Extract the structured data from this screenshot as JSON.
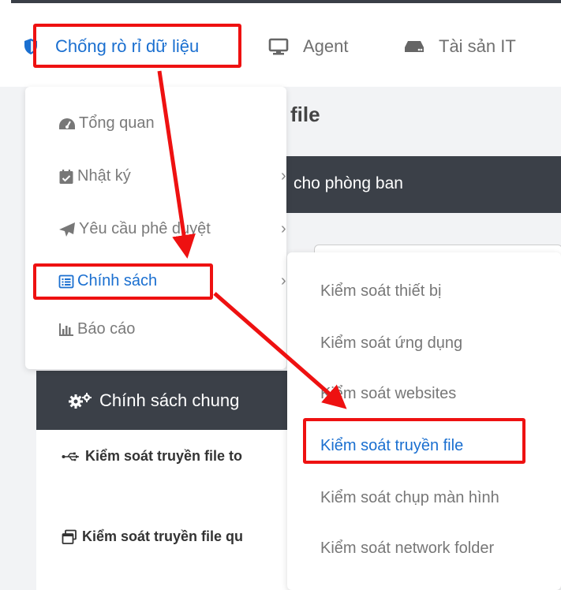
{
  "navbar": {
    "items": [
      {
        "label": "Chống rò rỉ dữ liệu",
        "icon": "shield-icon",
        "active": true
      },
      {
        "label": "Agent",
        "icon": "monitor-icon"
      },
      {
        "label": "Tài sản IT",
        "icon": "hard-drive-icon"
      }
    ]
  },
  "page": {
    "title_fragment": "file",
    "dark_bar_text": "cho phòng ban"
  },
  "menu": {
    "items": [
      {
        "label": "Tổng quan",
        "icon": "dashboard-gauge-icon"
      },
      {
        "label": "Nhật ký",
        "icon": "calendar-check-icon",
        "chevron": "›"
      },
      {
        "label": "Yêu cầu phê duyệt",
        "icon": "paper-plane-icon",
        "chevron": "›"
      },
      {
        "label": "Chính sách",
        "icon": "list-alt-icon",
        "chevron": "›",
        "active": true
      },
      {
        "label": "Báo cáo",
        "icon": "bar-chart-icon"
      }
    ]
  },
  "submenu": {
    "items": [
      {
        "label": "Kiểm soát thiết bị"
      },
      {
        "label": "Kiểm soát ứng dụng"
      },
      {
        "label": "Kiểm soát websites"
      },
      {
        "label": "Kiểm soát truyền file",
        "active": true
      },
      {
        "label": "Kiểm soát chụp màn hình"
      },
      {
        "label": "Kiểm soát network folder"
      }
    ]
  },
  "policy_panel": {
    "header": "Chính sách chung",
    "rows": [
      {
        "label": "Kiểm soát truyền file to",
        "icon": "usb-icon"
      },
      {
        "label": "Kiểm soát truyền file qu",
        "icon": "window-restore-icon"
      }
    ]
  },
  "annotation": {
    "highlight_color": "#ee1111",
    "accent": "#1a6fd0"
  }
}
